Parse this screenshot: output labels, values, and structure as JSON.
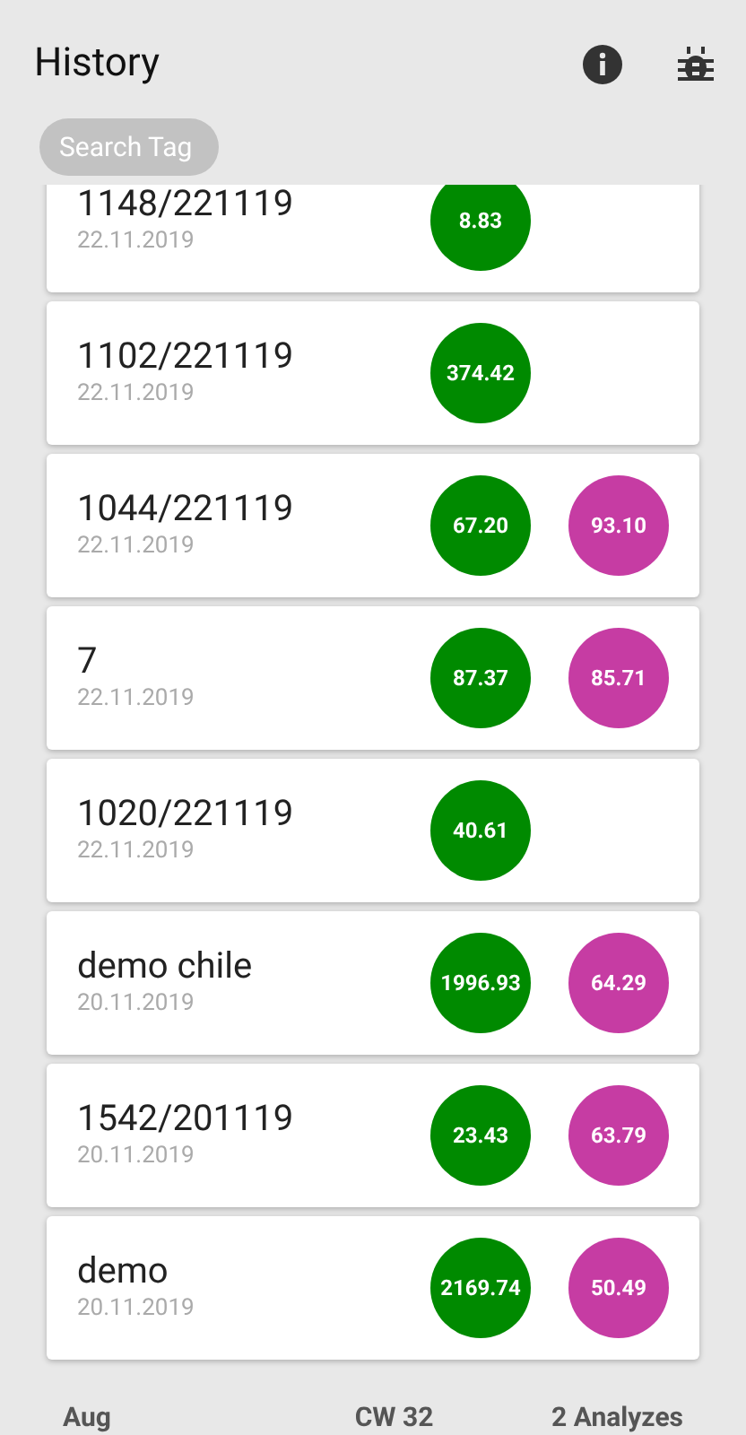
{
  "title": "History",
  "search": {
    "placeholder": "Search Tag"
  },
  "entries": [
    {
      "tag": "1148/221119",
      "date": "22.11.2019",
      "values": [
        {
          "text": "8.83",
          "color": "#008a00"
        }
      ]
    },
    {
      "tag": "1102/221119",
      "date": "22.11.2019",
      "values": [
        {
          "text": "374.42",
          "color": "#008a00"
        }
      ]
    },
    {
      "tag": "1044/221119",
      "date": "22.11.2019",
      "values": [
        {
          "text": "67.20",
          "color": "#008a00"
        },
        {
          "text": "93.10",
          "color": "#c63ca3"
        }
      ]
    },
    {
      "tag": "7",
      "date": "22.11.2019",
      "values": [
        {
          "text": "87.37",
          "color": "#008a00"
        },
        {
          "text": "85.71",
          "color": "#c63ca3"
        }
      ]
    },
    {
      "tag": "1020/221119",
      "date": "22.11.2019",
      "values": [
        {
          "text": "40.61",
          "color": "#008a00"
        }
      ]
    },
    {
      "tag": "demo chile",
      "date": "20.11.2019",
      "values": [
        {
          "text": "1996.93",
          "color": "#008a00"
        },
        {
          "text": "64.29",
          "color": "#c63ca3"
        }
      ]
    },
    {
      "tag": "1542/201119",
      "date": "20.11.2019",
      "values": [
        {
          "text": "23.43",
          "color": "#008a00"
        },
        {
          "text": "63.79",
          "color": "#c63ca3"
        }
      ]
    },
    {
      "tag": "demo",
      "date": "20.11.2019",
      "values": [
        {
          "text": "2169.74",
          "color": "#008a00"
        },
        {
          "text": "50.49",
          "color": "#c63ca3"
        }
      ]
    }
  ],
  "group": {
    "month": "Aug",
    "week": "CW 32",
    "count": "2 Analyzes"
  }
}
